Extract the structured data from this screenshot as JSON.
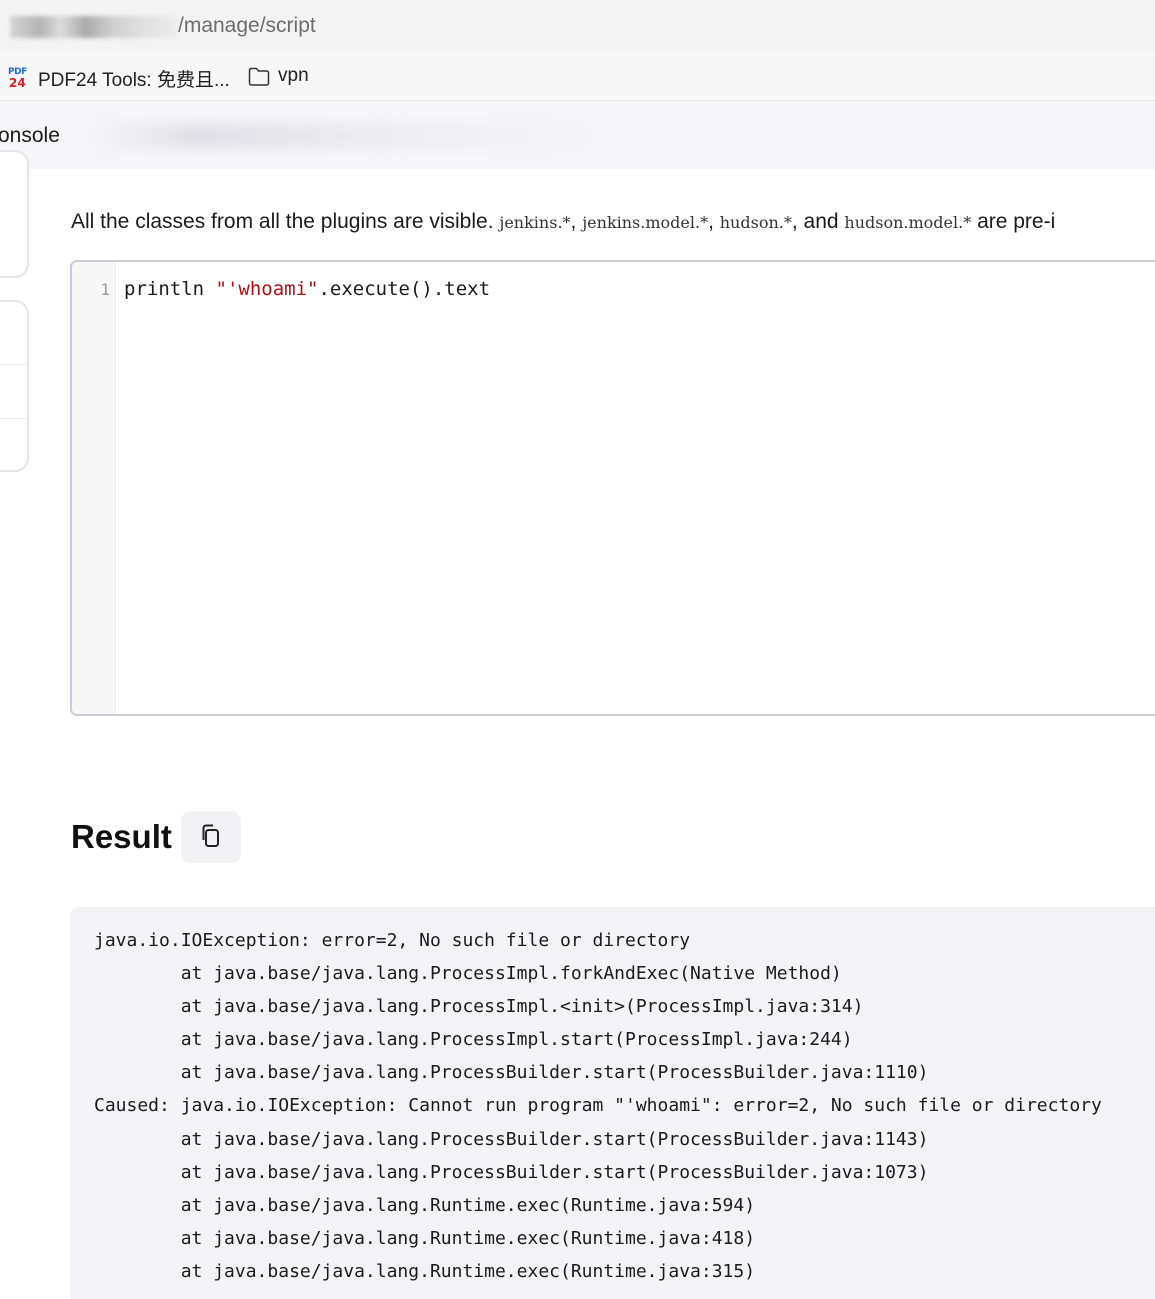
{
  "browser": {
    "url_path": "/manage/script",
    "bookmarks": [
      {
        "label": "PDF24 Tools: 免费且...",
        "icon": "pdf24-icon"
      },
      {
        "label": "vpn",
        "icon": "folder-icon"
      }
    ]
  },
  "header": {
    "title_partial": "onsole"
  },
  "description": {
    "lead": "All the classes from all the plugins are visible.",
    "pkg1": "jenkins.*",
    "pkg2": "jenkins.model.*",
    "pkg3": "hudson.*",
    "and": "and",
    "pkg4": "hudson.model.*",
    "tail": "are pre-i"
  },
  "editor": {
    "line_number": "1",
    "code_prefix": "println ",
    "code_string": "\"'whoami\"",
    "code_suffix": ".execute().text"
  },
  "result": {
    "title": "Result",
    "copy_icon": "copy-icon",
    "lines": [
      "java.io.IOException: error=2, No such file or directory",
      "        at java.base/java.lang.ProcessImpl.forkAndExec(Native Method)",
      "        at java.base/java.lang.ProcessImpl.<init>(ProcessImpl.java:314)",
      "        at java.base/java.lang.ProcessImpl.start(ProcessImpl.java:244)",
      "        at java.base/java.lang.ProcessBuilder.start(ProcessBuilder.java:1110)",
      "Caused: java.io.IOException: Cannot run program \"'whoami\": error=2, No such file or directory",
      "        at java.base/java.lang.ProcessBuilder.start(ProcessBuilder.java:1143)",
      "        at java.base/java.lang.ProcessBuilder.start(ProcessBuilder.java:1073)",
      "        at java.base/java.lang.Runtime.exec(Runtime.java:594)",
      "        at java.base/java.lang.Runtime.exec(Runtime.java:418)",
      "        at java.base/java.lang.Runtime.exec(Runtime.java:315)"
    ]
  },
  "colors": {
    "string_literal": "#aa1111",
    "editor_border": "#c9ccd2",
    "output_bg": "#f3f3f5"
  }
}
